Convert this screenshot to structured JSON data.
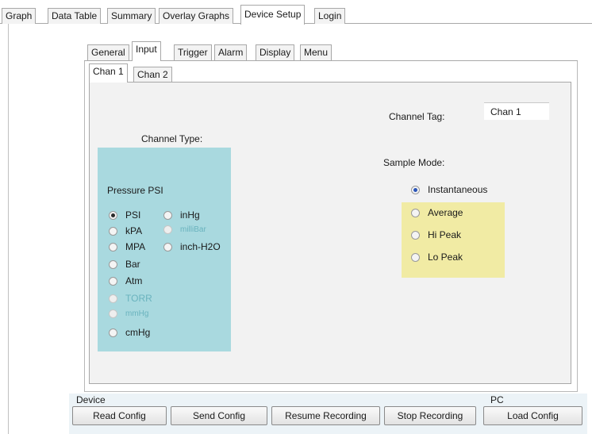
{
  "top_tabs": [
    "Graph",
    "Data Table",
    "Summary",
    "Overlay Graphs",
    "Device Setup",
    "Login"
  ],
  "sub_tabs": [
    "General",
    "Input",
    "Trigger",
    "Alarm",
    "Display",
    "Menu"
  ],
  "channel_tabs": [
    "Chan 1",
    "Chan 2"
  ],
  "channel_type": {
    "title": "Channel Type:",
    "header": "Pressure PSI",
    "units": [
      "PSI",
      "kPA",
      "MPA",
      "Bar",
      "Atm",
      "TORR",
      "mmHg",
      "cmHg"
    ],
    "units_col2": [
      "inHg",
      "milliBar",
      "inch-H2O"
    ],
    "selected": "PSI"
  },
  "channel_tag": {
    "label": "Channel Tag:",
    "value": "Chan 1"
  },
  "sample_mode": {
    "label": "Sample Mode:",
    "options": [
      "Instantaneous",
      "Average",
      "Hi Peak",
      "Lo Peak"
    ],
    "selected": "Instantaneous"
  },
  "footer": {
    "device_label": "Device",
    "pc_label": "PC",
    "buttons": {
      "read": "Read Config",
      "send": "Send Config",
      "resume": "Resume Recording",
      "stop": "Stop Recording",
      "load": "Load Config"
    }
  },
  "colors": {
    "channel_type_bg": "#a9d9df",
    "sample_mode_bg": "#f1eba4",
    "disabled_text": "#6ab3be",
    "selected_radio": "#2b55b8"
  }
}
